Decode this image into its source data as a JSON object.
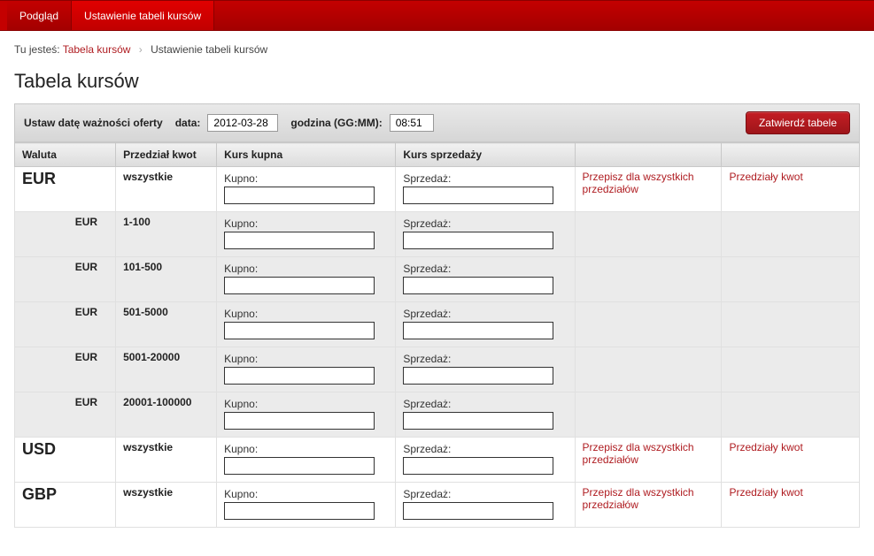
{
  "topbar": {
    "tabs": [
      {
        "label": "Podgląd",
        "active": false
      },
      {
        "label": "Ustawienie tabeli kursów",
        "active": true
      }
    ]
  },
  "breadcrumb": {
    "prefix": "Tu jesteś:",
    "link_label": "Tabela kursów",
    "separator": "›",
    "current": "Ustawienie tabeli kursów"
  },
  "page_title": "Tabela kursów",
  "filter": {
    "label_main": "Ustaw datę ważności oferty",
    "label_date": "data:",
    "date_value": "2012-03-28",
    "label_time": "godzina (GG:MM):",
    "time_value": "08:51",
    "confirm_label": "Zatwierdź tabele"
  },
  "table": {
    "headers": {
      "currency": "Waluta",
      "range": "Przedział kwot",
      "buy": "Kurs kupna",
      "sell": "Kurs sprzedaży",
      "action1": "",
      "action2": ""
    },
    "labels": {
      "buy_label": "Kupno:",
      "sell_label": "Sprzedaż:",
      "copy_all": "Przepisz dla wszystkich przedziałów",
      "ranges_link": "Przedziały kwot"
    },
    "rows": [
      {
        "type": "main",
        "currency": "EUR",
        "range": "wszystkie",
        "show_actions": true
      },
      {
        "type": "sub",
        "currency": "EUR",
        "range": "1-100",
        "show_actions": false
      },
      {
        "type": "sub",
        "currency": "EUR",
        "range": "101-500",
        "show_actions": false
      },
      {
        "type": "sub",
        "currency": "EUR",
        "range": "501-5000",
        "show_actions": false
      },
      {
        "type": "sub",
        "currency": "EUR",
        "range": "5001-20000",
        "show_actions": false
      },
      {
        "type": "sub",
        "currency": "EUR",
        "range": "20001-100000",
        "show_actions": false
      },
      {
        "type": "main",
        "currency": "USD",
        "range": "wszystkie",
        "show_actions": true
      },
      {
        "type": "main",
        "currency": "GBP",
        "range": "wszystkie",
        "show_actions": true
      }
    ]
  }
}
